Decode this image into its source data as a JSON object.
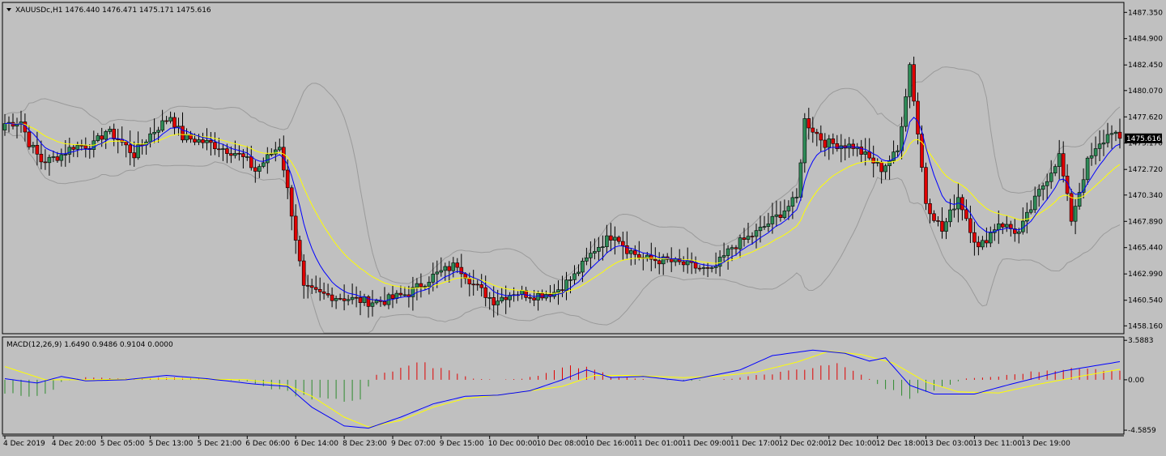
{
  "header": {
    "symbol_line": "XAUUSDc,H1  1476.440 1476.471 1475.171 1475.616",
    "macd_line": "MACD(12,26,9) 1.6490 0.9486 0.9104 0.0000"
  },
  "colors": {
    "background": "#c0c0c0",
    "bull": "#2e8b57",
    "bear": "#e00000",
    "ma_fast": "#0000ff",
    "ma_slow": "#ffff00",
    "bands": "#9a9a9a",
    "hist_pos": "#e00000",
    "hist_neg": "#2e8b2e"
  },
  "chart_data": [
    {
      "type": "candlestick",
      "title": "XAUUSDc,H1",
      "last_price_label": "1475.616",
      "ylim": [
        1457.5,
        1488.2
      ],
      "y_ticks": [
        "1487.350",
        "1484.900",
        "1482.450",
        "1480.070",
        "1477.620",
        "1475.170",
        "1472.720",
        "1470.340",
        "1467.890",
        "1465.440",
        "1462.990",
        "1460.540",
        "1458.160"
      ],
      "x_labels": [
        "4 Dec 2019",
        "4 Dec 20:00",
        "5 Dec 05:00",
        "5 Dec 13:00",
        "5 Dec 21:00",
        "6 Dec 06:00",
        "6 Dec 14:00",
        "8 Dec 23:00",
        "9 Dec 07:00",
        "9 Dec 15:00",
        "10 Dec 00:00",
        "10 Dec 08:00",
        "10 Dec 16:00",
        "11 Dec 01:00",
        "11 Dec 09:00",
        "11 Dec 17:00",
        "12 Dec 02:00",
        "12 Dec 10:00",
        "12 Dec 18:00",
        "13 Dec 03:00",
        "13 Dec 11:00",
        "13 Dec 19:00"
      ],
      "anchors": [
        [
          0,
          1477.0
        ],
        [
          4,
          1477.2
        ],
        [
          6,
          1475.2
        ],
        [
          9,
          1473.5
        ],
        [
          11,
          1473.6
        ],
        [
          14,
          1474.1
        ],
        [
          17,
          1474.9
        ],
        [
          22,
          1475.0
        ],
        [
          25,
          1476.3
        ],
        [
          28,
          1475.6
        ],
        [
          32,
          1474.1
        ],
        [
          36,
          1476.0
        ],
        [
          41,
          1477.7
        ],
        [
          44,
          1475.7
        ],
        [
          47,
          1475.5
        ],
        [
          51,
          1475.1
        ],
        [
          54,
          1474.7
        ],
        [
          57,
          1474.3
        ],
        [
          60,
          1473.5
        ],
        [
          62,
          1472.6
        ],
        [
          68,
          1475.0
        ],
        [
          71,
          1468.7
        ],
        [
          74,
          1461.6
        ],
        [
          78,
          1461.1
        ],
        [
          85,
          1460.7
        ],
        [
          90,
          1460.4
        ],
        [
          94,
          1460.5
        ],
        [
          100,
          1461.2
        ],
        [
          106,
          1462.8
        ],
        [
          112,
          1463.9
        ],
        [
          116,
          1462.0
        ],
        [
          121,
          1460.5
        ],
        [
          126,
          1461.3
        ],
        [
          131,
          1461.0
        ],
        [
          136,
          1461.3
        ],
        [
          141,
          1462.8
        ],
        [
          146,
          1465.3
        ],
        [
          151,
          1466.8
        ],
        [
          154,
          1465.3
        ],
        [
          158,
          1464.4
        ],
        [
          164,
          1464.2
        ],
        [
          169,
          1463.8
        ],
        [
          175,
          1463.2
        ],
        [
          180,
          1465.5
        ],
        [
          186,
          1466.8
        ],
        [
          191,
          1468.3
        ],
        [
          196,
          1470.0
        ],
        [
          198,
          1477.3
        ],
        [
          203,
          1475.2
        ],
        [
          210,
          1474.9
        ],
        [
          217,
          1472.8
        ],
        [
          221,
          1474.4
        ],
        [
          224,
          1482.5
        ],
        [
          228,
          1469.7
        ],
        [
          232,
          1467.0
        ],
        [
          236,
          1470.2
        ],
        [
          241,
          1465.3
        ],
        [
          246,
          1467.8
        ],
        [
          251,
          1466.8
        ],
        [
          256,
          1470.6
        ],
        [
          261,
          1474.0
        ],
        [
          264,
          1468.1
        ],
        [
          268,
          1473.4
        ],
        [
          274,
          1476.4
        ],
        [
          276,
          1475.6
        ]
      ],
      "x_label_bars": [
        0,
        12,
        24,
        36,
        48,
        60,
        72,
        84,
        96,
        108,
        120,
        132,
        144,
        156,
        168,
        180,
        192,
        204,
        216,
        228,
        240,
        252
      ]
    },
    {
      "type": "macd",
      "title": "MACD(12,26,9)",
      "values": {
        "macd": 1.649,
        "signal": 0.9486,
        "histogram": 0.9104,
        "zero": 0.0
      },
      "ylim": [
        -4.8,
        3.75
      ],
      "y_ticks": [
        "3.5883",
        "0.00",
        "-4.5859"
      ],
      "hist_anchors": [
        [
          0,
          -1.45
        ],
        [
          10,
          -1.4
        ],
        [
          14,
          -0.2
        ],
        [
          20,
          0.25
        ],
        [
          30,
          0.1
        ],
        [
          40,
          0.2
        ],
        [
          50,
          0.1
        ],
        [
          60,
          -0.15
        ],
        [
          68,
          -1.0
        ],
        [
          80,
          -2.0
        ],
        [
          88,
          -1.7
        ],
        [
          92,
          0.4
        ],
        [
          103,
          1.5
        ],
        [
          112,
          0.6
        ],
        [
          116,
          0.1
        ],
        [
          122,
          0.0
        ],
        [
          128,
          0.1
        ],
        [
          133,
          0.5
        ],
        [
          140,
          1.2
        ],
        [
          145,
          1.2
        ],
        [
          150,
          0.3
        ],
        [
          160,
          0.0
        ],
        [
          170,
          -0.1
        ],
        [
          180,
          0.1
        ],
        [
          195,
          0.8
        ],
        [
          205,
          1.5
        ],
        [
          212,
          0.5
        ],
        [
          218,
          -0.8
        ],
        [
          224,
          -1.6
        ],
        [
          230,
          -0.9
        ],
        [
          238,
          0.1
        ],
        [
          246,
          0.3
        ],
        [
          252,
          0.6
        ],
        [
          262,
          1.0
        ],
        [
          276,
          0.9
        ]
      ],
      "macd_anchors": [
        [
          0,
          0.1
        ],
        [
          8,
          -0.3
        ],
        [
          14,
          0.3
        ],
        [
          20,
          -0.1
        ],
        [
          30,
          0.0
        ],
        [
          40,
          0.4
        ],
        [
          50,
          0.1
        ],
        [
          62,
          -0.4
        ],
        [
          70,
          -0.6
        ],
        [
          76,
          -2.5
        ],
        [
          84,
          -4.2
        ],
        [
          90,
          -4.4
        ],
        [
          98,
          -3.4
        ],
        [
          106,
          -2.2
        ],
        [
          114,
          -1.5
        ],
        [
          122,
          -1.4
        ],
        [
          130,
          -1.0
        ],
        [
          138,
          0.0
        ],
        [
          144,
          0.9
        ],
        [
          150,
          0.2
        ],
        [
          158,
          0.3
        ],
        [
          168,
          -0.1
        ],
        [
          174,
          0.3
        ],
        [
          182,
          0.9
        ],
        [
          190,
          2.2
        ],
        [
          200,
          2.7
        ],
        [
          208,
          2.4
        ],
        [
          214,
          1.7
        ],
        [
          218,
          2.0
        ],
        [
          224,
          -0.5
        ],
        [
          230,
          -1.3
        ],
        [
          240,
          -1.3
        ],
        [
          248,
          -0.5
        ],
        [
          262,
          0.8
        ],
        [
          276,
          1.649
        ]
      ],
      "signal_anchors": [
        [
          0,
          1.2
        ],
        [
          10,
          0.0
        ],
        [
          20,
          0.0
        ],
        [
          40,
          0.1
        ],
        [
          60,
          0.0
        ],
        [
          70,
          -0.5
        ],
        [
          76,
          -1.5
        ],
        [
          84,
          -3.4
        ],
        [
          90,
          -4.3
        ],
        [
          98,
          -3.7
        ],
        [
          106,
          -2.5
        ],
        [
          114,
          -1.7
        ],
        [
          122,
          -1.4
        ],
        [
          138,
          -0.6
        ],
        [
          146,
          0.4
        ],
        [
          154,
          0.4
        ],
        [
          168,
          0.2
        ],
        [
          176,
          0.3
        ],
        [
          186,
          0.7
        ],
        [
          196,
          1.6
        ],
        [
          204,
          2.6
        ],
        [
          212,
          2.3
        ],
        [
          220,
          1.5
        ],
        [
          228,
          -0.2
        ],
        [
          236,
          -1.1
        ],
        [
          246,
          -1.2
        ],
        [
          256,
          -0.4
        ],
        [
          266,
          0.3
        ],
        [
          276,
          0.9486
        ]
      ]
    }
  ]
}
